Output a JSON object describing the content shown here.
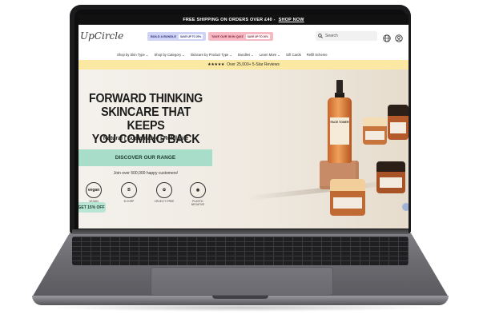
{
  "announcement": {
    "text": "FREE SHIPPING ON ORDERS OVER £40 -",
    "link": "SHOP NOW"
  },
  "header": {
    "logo": "UpCircle",
    "promo_bundle": {
      "label": "BUILD A BUNDLE",
      "tag": "SAVE UP TO 20%"
    },
    "promo_quiz": {
      "label": "TAKE OUR SKIN QUIZ",
      "tag": "SAVE UP TO 20%"
    },
    "search_placeholder": "Search",
    "icons": [
      "search-icon",
      "globe-icon",
      "account-icon"
    ]
  },
  "nav": {
    "items": [
      "Shop by Skin Type ⌄",
      "Shop by Category ⌄",
      "Skincare by Product Type ⌄",
      "Bundles ⌄",
      "Learn More ⌄",
      "Gift Cards",
      "Refill Scheme"
    ]
  },
  "reviews_bar": {
    "stars": "★★★★★",
    "text": "Over 25,000+ 5-Star Reviews"
  },
  "hero": {
    "headline_1": "FORWARD THINKING",
    "headline_2": "SKINCARE THAT KEEPS",
    "headline_3": "YOU COMING BACK",
    "subline": "Natural | Sustainable | Refillable",
    "cta": "DISCOVER OUR RANGE",
    "join": "Join over 500,000 happy customers!",
    "badges": [
      {
        "icon": "vegan",
        "label": "VEGAN"
      },
      {
        "icon": "B",
        "label": "B CORP"
      },
      {
        "icon": "✿",
        "label": "CRUELTY-FREE"
      },
      {
        "icon": "◉",
        "label": "PLASTIC NEGATIVE"
      }
    ],
    "discount_tab": "GET 15% OFF",
    "product_label": "FACE TONER"
  },
  "colors": {
    "announcement_bg": "#111111",
    "reviews_bg": "#fbe9a3",
    "cta_bg": "#a8ddc9",
    "bundle_pill": "#cfd3f6",
    "quiz_pill": "#f7b9c4"
  }
}
